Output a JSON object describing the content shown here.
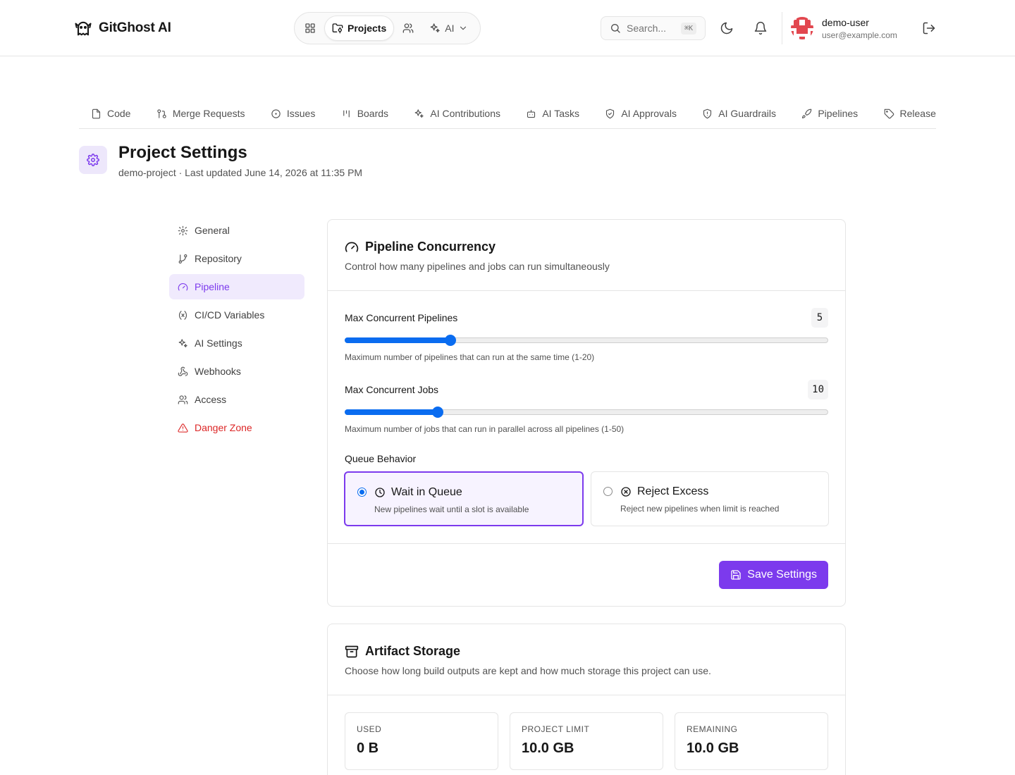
{
  "app": {
    "name": "GitGhost AI"
  },
  "topnav": {
    "projects": "Projects",
    "ai": "AI"
  },
  "search": {
    "placeholder": "Search...",
    "shortcut": "⌘K"
  },
  "user": {
    "name": "demo-user",
    "email": "user@example.com"
  },
  "project_tabs": [
    {
      "label": "Code",
      "icon": "file-icon"
    },
    {
      "label": "Merge Requests",
      "icon": "git-pull-request-icon"
    },
    {
      "label": "Issues",
      "icon": "circle-dot-icon"
    },
    {
      "label": "Boards",
      "icon": "kanban-icon"
    },
    {
      "label": "AI Contributions",
      "icon": "sparkles-icon"
    },
    {
      "label": "AI Tasks",
      "icon": "bot-icon"
    },
    {
      "label": "AI Approvals",
      "icon": "shield-check-icon"
    },
    {
      "label": "AI Guardrails",
      "icon": "shield-alert-icon"
    },
    {
      "label": "Pipelines",
      "icon": "rocket-icon"
    },
    {
      "label": "Release",
      "icon": "tag-icon"
    }
  ],
  "page": {
    "title": "Project Settings",
    "subtitle": "demo-project · Last updated June 14, 2026 at 11:35 PM"
  },
  "sidenav": [
    {
      "label": "General",
      "icon": "gear-icon"
    },
    {
      "label": "Repository",
      "icon": "git-branch-icon"
    },
    {
      "label": "Pipeline",
      "icon": "gauge-icon",
      "active": true
    },
    {
      "label": "CI/CD Variables",
      "icon": "variable-icon"
    },
    {
      "label": "AI Settings",
      "icon": "sparkles-icon"
    },
    {
      "label": "Webhooks",
      "icon": "webhook-icon"
    },
    {
      "label": "Access",
      "icon": "users-icon"
    },
    {
      "label": "Danger Zone",
      "icon": "warning-icon",
      "danger": true
    }
  ],
  "concurrency": {
    "title": "Pipeline Concurrency",
    "description": "Control how many pipelines and jobs can run simultaneously",
    "max_pipelines": {
      "label": "Max Concurrent Pipelines",
      "value": "5",
      "min": 1,
      "max": 20,
      "hint": "Maximum number of pipelines that can run at the same time (1-20)"
    },
    "max_jobs": {
      "label": "Max Concurrent Jobs",
      "value": "10",
      "min": 1,
      "max": 50,
      "hint": "Maximum number of jobs that can run in parallel across all pipelines (1-50)"
    },
    "queue": {
      "label": "Queue Behavior",
      "options": [
        {
          "title": "Wait in Queue",
          "description": "New pipelines wait until a slot is available",
          "selected": true
        },
        {
          "title": "Reject Excess",
          "description": "Reject new pipelines when limit is reached",
          "selected": false
        }
      ]
    },
    "save_label": "Save Settings"
  },
  "storage": {
    "title": "Artifact Storage",
    "description": "Choose how long build outputs are kept and how much storage this project can use.",
    "stats": [
      {
        "label": "USED",
        "value": "0 B"
      },
      {
        "label": "PROJECT LIMIT",
        "value": "10.0 GB"
      },
      {
        "label": "REMAINING",
        "value": "10.0 GB"
      }
    ]
  },
  "colors": {
    "accent": "#7c3aed",
    "accent_soft": "#f0eafd",
    "slider": "#0a6cf0",
    "danger": "#dc2626"
  }
}
